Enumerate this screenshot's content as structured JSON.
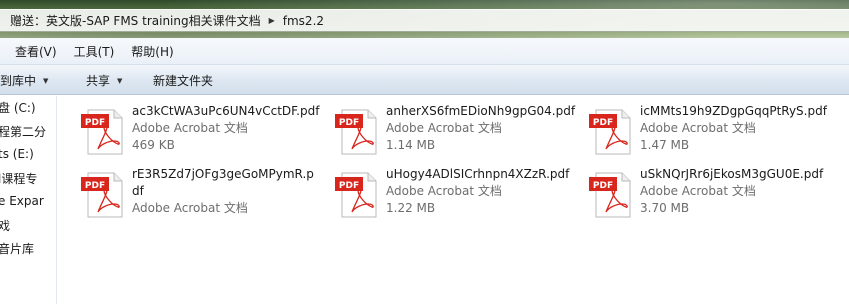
{
  "address": {
    "crumbs": [
      "赠送：英文版-SAP FMS training相关课件文档",
      "fms2.2"
    ]
  },
  "menu": {
    "items": [
      "查看(V)",
      "工具(T)",
      "帮助(H)"
    ]
  },
  "toolbar": {
    "burn_label": "录到库中",
    "share_label": "共享",
    "new_folder_label": "新建文件夹"
  },
  "nav": {
    "items": [
      "盘 (C:)",
      "程第二分",
      "ts (E:)",
      "l课程专",
      "e Expar",
      "戏",
      "音片库"
    ]
  },
  "files": [
    {
      "name": "ac3kCtWA3uPc6UN4vCctDF.pdf",
      "type": "Adobe Acrobat 文档",
      "size": "469 KB"
    },
    {
      "name": "anherXS6fmEDioNh9gpG04.pdf",
      "type": "Adobe Acrobat 文档",
      "size": "1.14 MB"
    },
    {
      "name": "icMMts19h9ZDgpGqqPtRyS.pdf",
      "type": "Adobe Acrobat 文档",
      "size": "1.47 MB"
    },
    {
      "name": "rE3R5Zd7jOFg3geGoMPymR.pdf",
      "type": "Adobe Acrobat 文档",
      "size": ""
    },
    {
      "name": "uHogy4ADlSICrhnpn4XZzR.pdf",
      "type": "Adobe Acrobat 文档",
      "size": "1.22 MB"
    },
    {
      "name": "uSkNQrJRr6jEkosM3gGU0E.pdf",
      "type": "Adobe Acrobat 文档",
      "size": "3.70 MB"
    }
  ],
  "icon_label": "PDF",
  "colors": {
    "pdf_red": "#d8261c",
    "toolbar_blue": "#dde7f1"
  }
}
